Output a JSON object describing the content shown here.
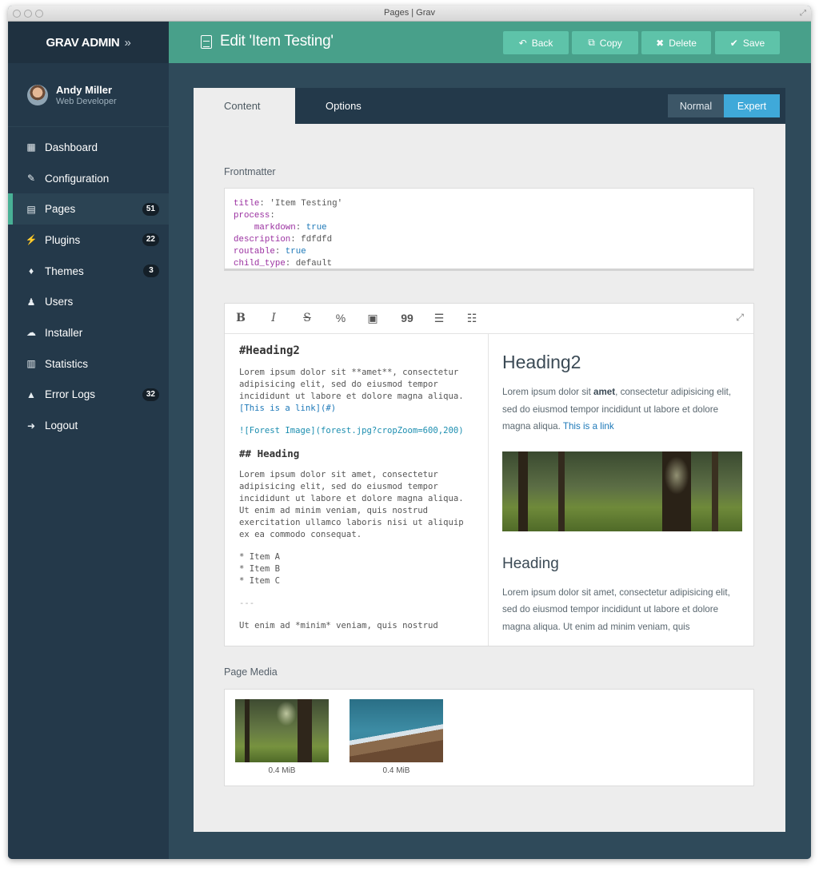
{
  "window": {
    "title": "Pages | Grav"
  },
  "sidebar": {
    "brand": "GRAV ADMIN",
    "brand_chevron": "»",
    "user": {
      "name": "Andy Miller",
      "role": "Web Developer"
    },
    "items": [
      {
        "label": "Dashboard",
        "icon": "grid-icon",
        "glyph": "▦",
        "badge": ""
      },
      {
        "label": "Configuration",
        "icon": "wrench-icon",
        "glyph": "✎",
        "badge": ""
      },
      {
        "label": "Pages",
        "icon": "file-icon",
        "glyph": "▤",
        "badge": "51",
        "active": true
      },
      {
        "label": "Plugins",
        "icon": "plug-icon",
        "glyph": "⚡",
        "badge": "22"
      },
      {
        "label": "Themes",
        "icon": "droplet-icon",
        "glyph": "♦",
        "badge": "3"
      },
      {
        "label": "Users",
        "icon": "user-icon",
        "glyph": "♟",
        "badge": ""
      },
      {
        "label": "Installer",
        "icon": "cloud-download-icon",
        "glyph": "☁",
        "badge": ""
      },
      {
        "label": "Statistics",
        "icon": "bar-chart-icon",
        "glyph": "▥",
        "badge": ""
      },
      {
        "label": "Error Logs",
        "icon": "warning-icon",
        "glyph": "▲",
        "badge": "32"
      },
      {
        "label": "Logout",
        "icon": "sign-out-icon",
        "glyph": "➜",
        "badge": ""
      }
    ]
  },
  "header": {
    "title": "Edit 'Item Testing'",
    "buttons": {
      "back": "Back",
      "copy": "Copy",
      "delete": "Delete",
      "save": "Save"
    }
  },
  "tabs": {
    "content": "Content",
    "options": "Options"
  },
  "mode": {
    "normal": "Normal",
    "expert": "Expert"
  },
  "frontmatter": {
    "label": "Frontmatter",
    "lines": [
      {
        "indent": "",
        "key": "title",
        "value": " 'Item Testing'",
        "value_class": ""
      },
      {
        "indent": "",
        "key": "process",
        "value": "",
        "value_class": ""
      },
      {
        "indent": "    ",
        "key": "markdown",
        "value": " true",
        "value_class": "bl"
      },
      {
        "indent": "",
        "key": "description",
        "value": " fdfdfd",
        "value_class": ""
      },
      {
        "indent": "",
        "key": "routable",
        "value": " true",
        "value_class": "bl"
      },
      {
        "indent": "",
        "key": "child_type",
        "value": " default",
        "value_class": ""
      }
    ]
  },
  "editor": {
    "toolbar": {
      "bold": "B",
      "italic": "I",
      "strike": "S",
      "link": "%",
      "image": "▣",
      "quote": "99",
      "ul": "☰",
      "ol": "☷"
    },
    "source": {
      "h2": "#Heading2",
      "p1_text": "Lorem ipsum dolor sit **amet**, consectetur adipisicing elit, sed do eiusmod tempor incididunt ut labore et dolore magna aliqua.",
      "p1_link": "[This is a link](#)",
      "image_md": "![Forest Image](forest.jpg?cropZoom=600,200)",
      "h3": "## Heading",
      "p2": "Lorem ipsum dolor sit amet, consectetur adipisicing elit, sed do eiusmod tempor incididunt ut labore et dolore magna aliqua. Ut enim ad minim veniam, quis nostrud exercitation ullamco laboris nisi ut aliquip ex ea commodo consequat.",
      "list": [
        "* Item A",
        "* Item B",
        "* Item C"
      ],
      "hr": "---",
      "p3": "Ut enim ad *minim* veniam, quis nostrud"
    },
    "preview": {
      "h2": "Heading2",
      "p1_before": "Lorem ipsum dolor sit ",
      "p1_bold": "amet",
      "p1_after": ", consectetur adipisicing elit, sed do eiusmod tempor incididunt ut labore et dolore magna aliqua. ",
      "p1_link": "This is a link",
      "h3": "Heading",
      "p2": "Lorem ipsum dolor sit amet, consectetur adipisicing elit, sed do eiusmod tempor incididunt ut labore et dolore magna aliqua. Ut enim ad minim veniam, quis"
    }
  },
  "media": {
    "label": "Page Media",
    "items": [
      {
        "size": "0.4 MiB"
      },
      {
        "size": "0.4 MiB"
      }
    ]
  },
  "colors": {
    "accent": "#48a08a",
    "sidebar": "#24394a",
    "expert": "#3fa9d9",
    "link": "#1c78b8"
  }
}
